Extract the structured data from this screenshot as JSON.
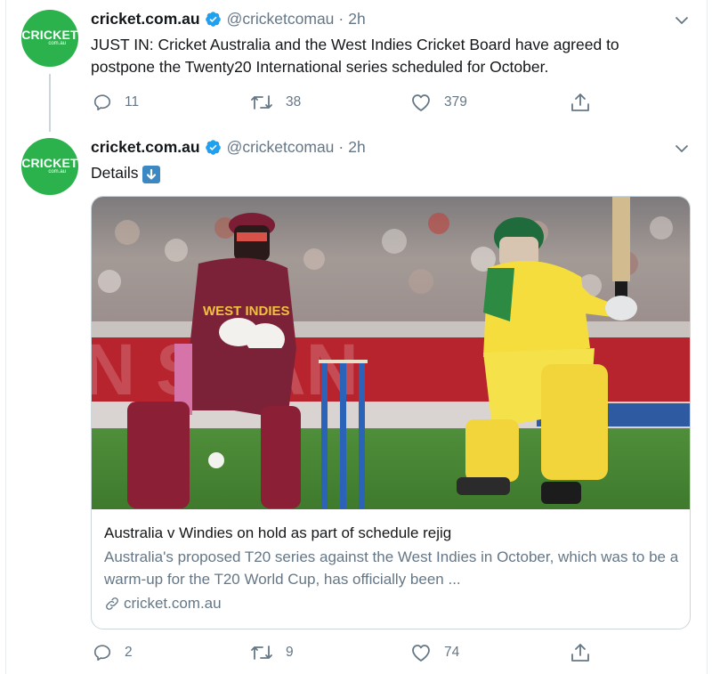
{
  "tweets": [
    {
      "avatar_text": "CRICKET",
      "avatar_sub": "com.au",
      "name": "cricket.com.au",
      "handle": "@cricketcomau",
      "separator": "·",
      "time": "2h",
      "text": "JUST IN: Cricket Australia and the West Indies Cricket Board have agreed to postpone the Twenty20 International series scheduled for October.",
      "replies": "11",
      "retweets": "38",
      "likes": "379"
    },
    {
      "avatar_text": "CRICKET",
      "avatar_sub": "com.au",
      "name": "cricket.com.au",
      "handle": "@cricketcomau",
      "separator": "·",
      "time": "2h",
      "text": "Details",
      "replies": "2",
      "retweets": "9",
      "likes": "74",
      "card": {
        "image_text_1": "WEST INDIES",
        "title": "Australia v Windies on hold as part of schedule rejig",
        "description": "Australia's proposed T20 series against the West Indies in October, which was to be a warm-up for the T20 World Cup, has officially been ...",
        "link": "cricket.com.au"
      }
    }
  ],
  "icons": {
    "verified": "verified-badge-icon",
    "caret": "chevron-down-icon",
    "reply": "reply-icon",
    "retweet": "retweet-icon",
    "like": "heart-icon",
    "share": "share-icon",
    "link": "link-icon",
    "emoji": "down-arrow-emoji"
  },
  "colors": {
    "avatar_bg": "#2bb24c",
    "verified": "#1da1f2",
    "muted": "#657786",
    "text": "#14171a"
  }
}
